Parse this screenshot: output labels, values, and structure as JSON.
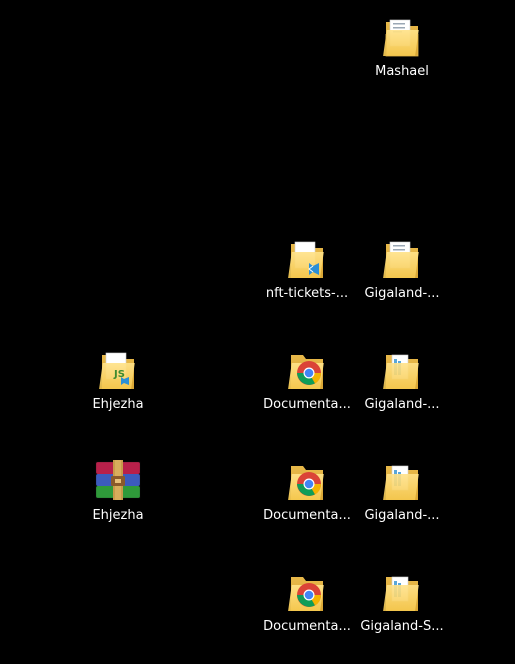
{
  "desktop": {
    "background": "#000000",
    "icons": [
      {
        "label": "Mashael",
        "type": "folder-docs"
      },
      {
        "label": "nft-tickets-...",
        "type": "folder-vscode"
      },
      {
        "label": "Gigaland-...",
        "type": "folder-docs"
      },
      {
        "label": "Ehjezha",
        "type": "folder-js"
      },
      {
        "label": "Documenta...",
        "type": "chrome-folder"
      },
      {
        "label": "Gigaland-...",
        "type": "folder-files"
      },
      {
        "label": "Ehjezha",
        "type": "winrar-archive"
      },
      {
        "label": "Documenta...",
        "type": "chrome-folder"
      },
      {
        "label": "Gigaland-...",
        "type": "folder-files"
      },
      {
        "label": "Documenta...",
        "type": "chrome-folder"
      },
      {
        "label": "Gigaland-S...",
        "type": "folder-files"
      }
    ]
  }
}
